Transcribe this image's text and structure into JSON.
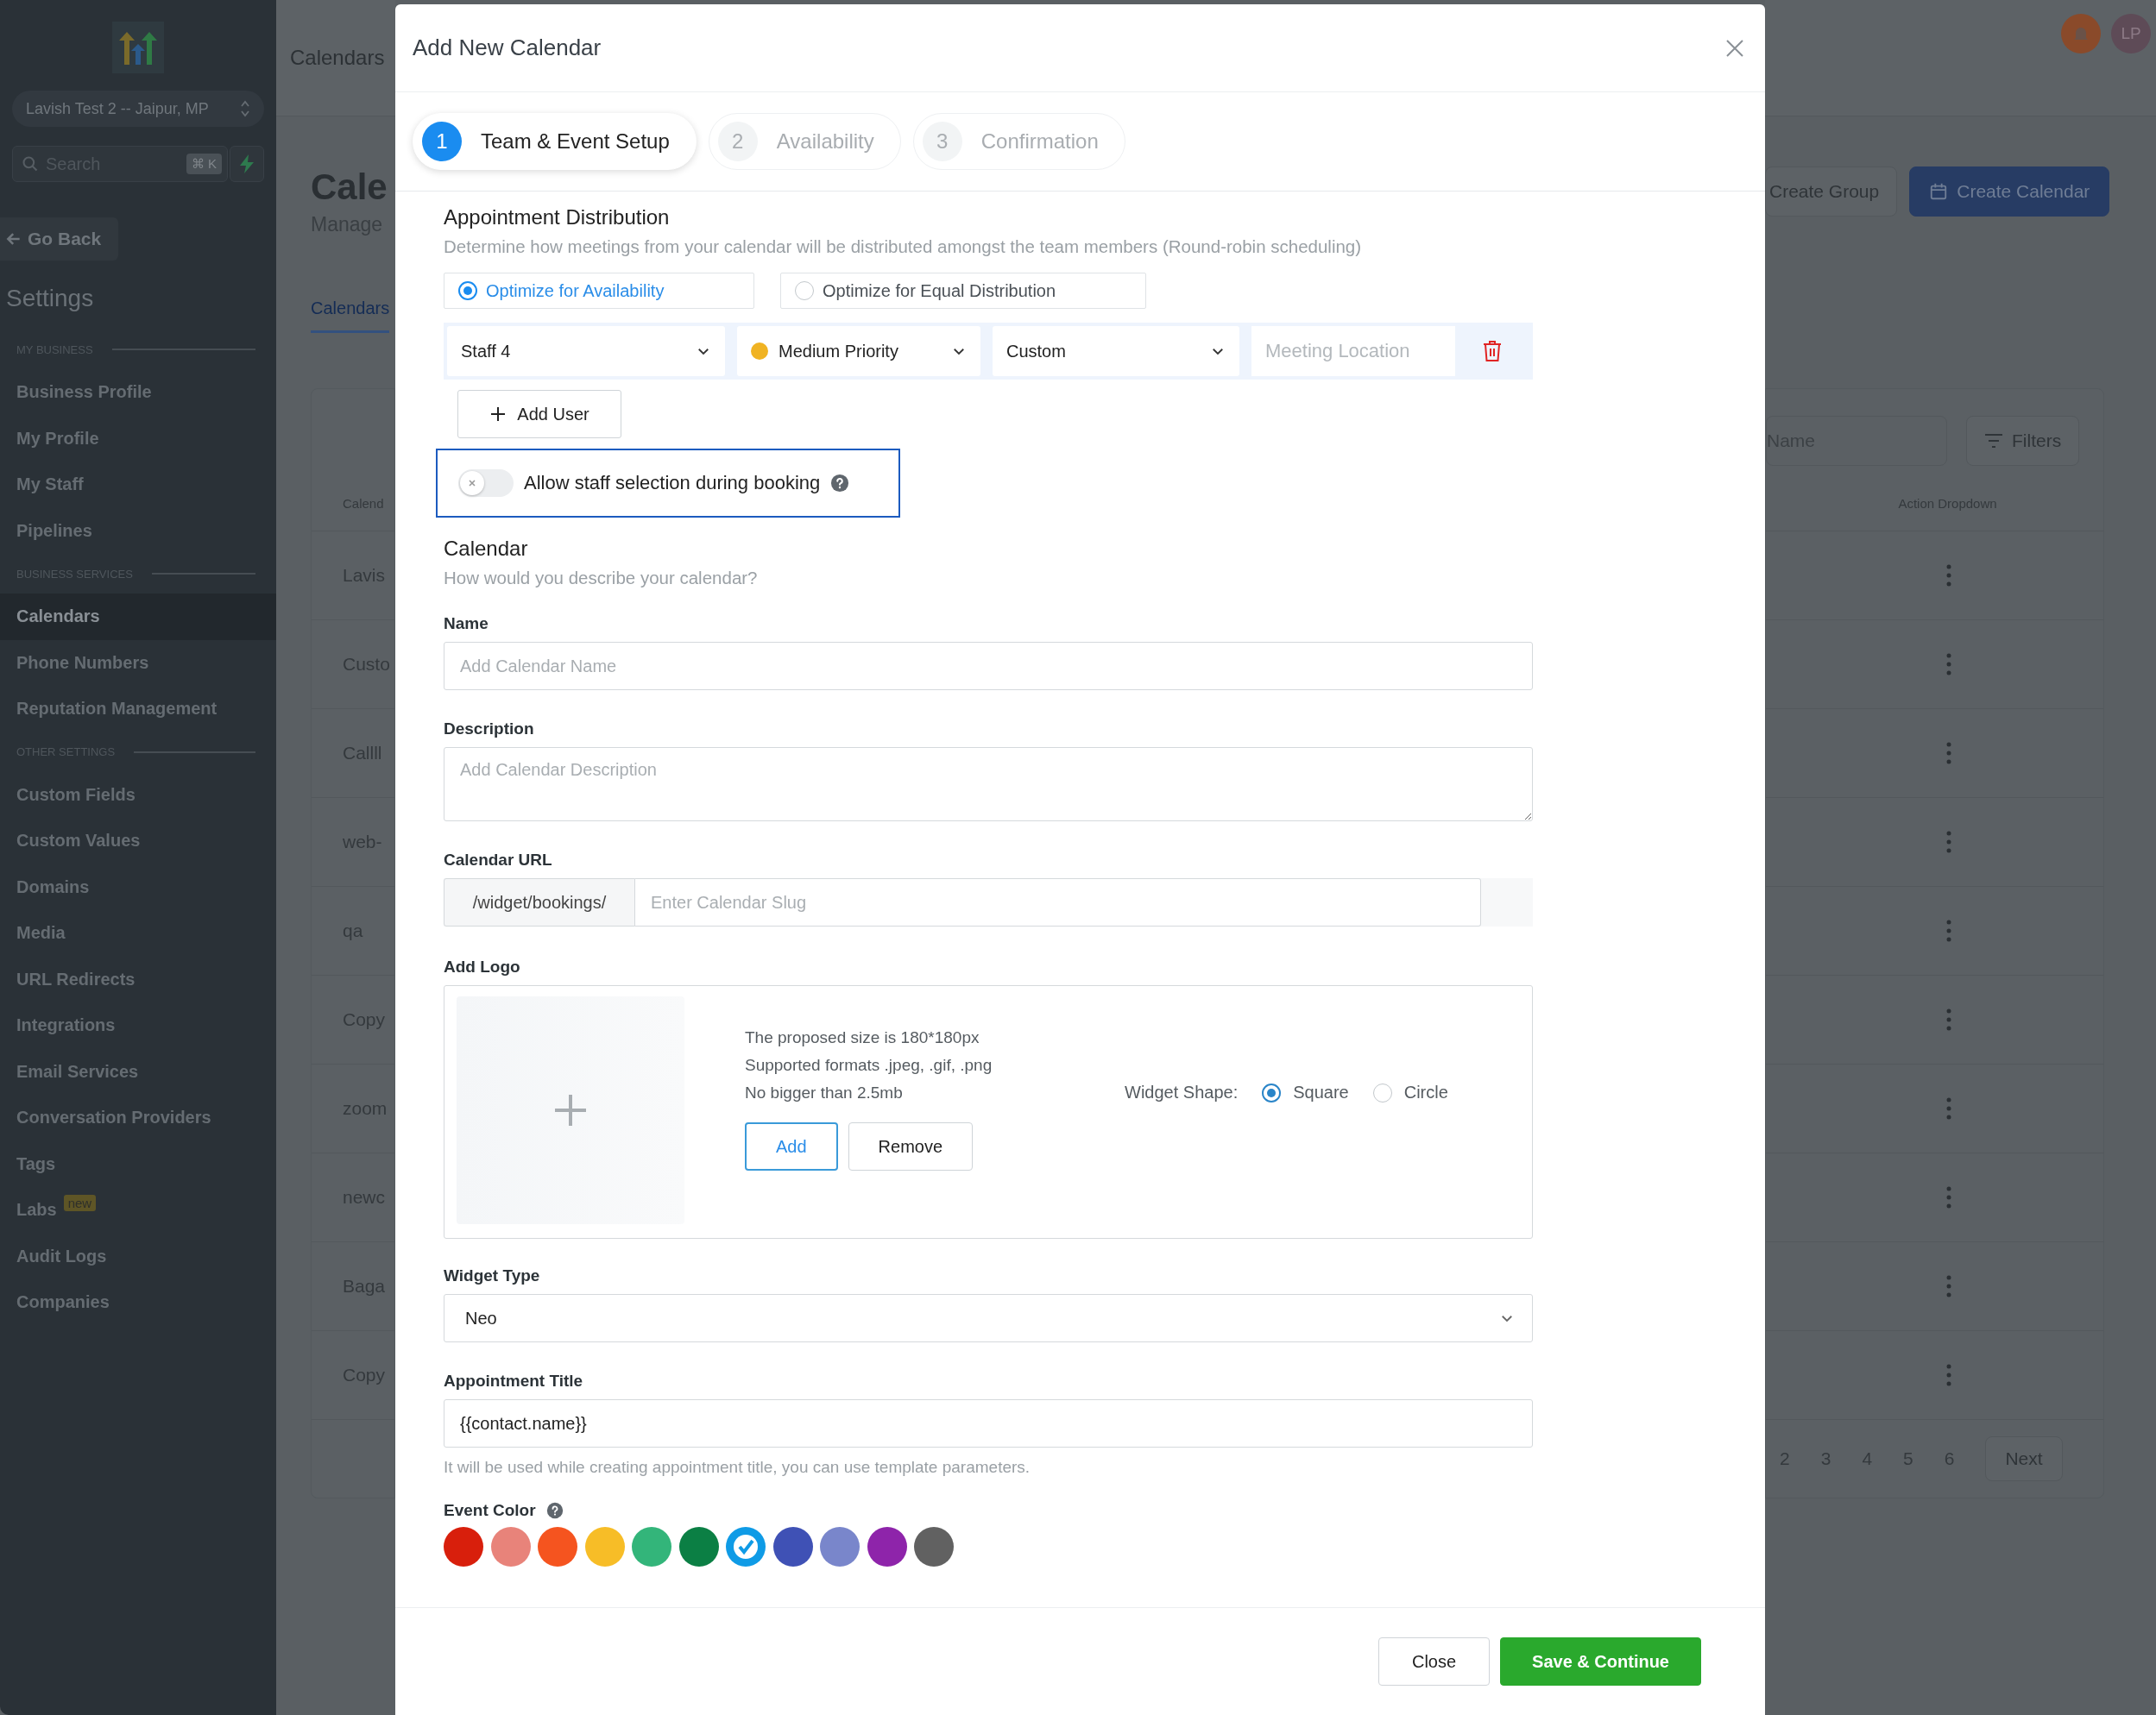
{
  "sidebar": {
    "account": "Lavish Test 2 -- Jaipur, MP",
    "search": {
      "placeholder": "Search",
      "shortcut": "⌘ K"
    },
    "back": "Go Back",
    "title": "Settings",
    "sections": [
      {
        "heading": "MY BUSINESS",
        "items": [
          {
            "label": "Business Profile",
            "selected": false
          },
          {
            "label": "My Profile",
            "selected": false
          },
          {
            "label": "My Staff",
            "selected": false
          },
          {
            "label": "Pipelines",
            "selected": false
          }
        ]
      },
      {
        "heading": "BUSINESS SERVICES",
        "items": [
          {
            "label": "Calendars",
            "selected": true
          },
          {
            "label": "Phone Numbers",
            "selected": false
          },
          {
            "label": "Reputation Management",
            "selected": false
          }
        ]
      },
      {
        "heading": "OTHER SETTINGS",
        "items": [
          {
            "label": "Custom Fields",
            "selected": false
          },
          {
            "label": "Custom Values",
            "selected": false
          },
          {
            "label": "Domains",
            "selected": false
          },
          {
            "label": "Media",
            "selected": false
          },
          {
            "label": "URL Redirects",
            "selected": false
          },
          {
            "label": "Integrations",
            "selected": false
          },
          {
            "label": "Email Services",
            "selected": false
          },
          {
            "label": "Conversation Providers",
            "selected": false
          },
          {
            "label": "Tags",
            "selected": false
          },
          {
            "label": "Labs",
            "selected": false,
            "badge": "new"
          },
          {
            "label": "Audit Logs",
            "selected": false
          },
          {
            "label": "Companies",
            "selected": false
          }
        ]
      }
    ]
  },
  "page": {
    "header": "Calendars",
    "title": "Cale",
    "subtitle": "Manage",
    "tabs": [
      {
        "label": "Calendars",
        "selected": true
      }
    ],
    "avatar": "LP",
    "create_group": "Create Group",
    "create_calendar": "Create Calendar",
    "search": {
      "placeholder": "Name"
    },
    "filters": "Filters",
    "columns": [
      "Calend",
      "Action Dropdown"
    ],
    "rows": [
      "Lavis",
      "Custo",
      "Callll",
      "web-",
      "qa",
      "Copy",
      "zoom",
      "newc",
      "Baga",
      "Copy"
    ],
    "pages": [
      "2",
      "3",
      "4",
      "5",
      "6"
    ],
    "next": "Next"
  },
  "modal": {
    "title": "Add New Calendar",
    "steps": [
      {
        "number": "1",
        "label": "Team & Event Setup",
        "selected": true
      },
      {
        "number": "2",
        "label": "Availability",
        "selected": false
      },
      {
        "number": "3",
        "label": "Confirmation",
        "selected": false
      }
    ],
    "distribution": {
      "title": "Appointment Distribution",
      "description": "Determine how meetings from your calendar will be distributed amongst the team members (Round-robin scheduling)",
      "options": [
        {
          "label": "Optimize for Availability",
          "selected": true
        },
        {
          "label": "Optimize for Equal Distribution",
          "selected": false
        }
      ],
      "staff": "Staff 4",
      "priority": "Medium Priority",
      "location": "Custom",
      "meeting_location": {
        "placeholder": "Meeting Location"
      },
      "add_user": "Add User",
      "staff_selection": {
        "label": "Allow staff selection during booking",
        "on": false
      }
    },
    "calendar": {
      "title": "Calendar",
      "description": "How would you describe your calendar?",
      "name": {
        "label": "Name",
        "placeholder": "Add Calendar Name"
      },
      "details": {
        "label": "Description",
        "placeholder": "Add Calendar Description"
      },
      "url": {
        "label": "Calendar URL",
        "prefix": "/widget/bookings/",
        "placeholder": "Enter Calendar Slug"
      },
      "logo": {
        "label": "Add Logo",
        "notes": [
          "The proposed size is 180*180px",
          "Supported formats .jpeg, .gif, .png",
          "No bigger than 2.5mb"
        ],
        "add": "Add",
        "remove": "Remove",
        "shape_label": "Widget Shape:",
        "shapes": [
          {
            "label": "Square",
            "selected": true
          },
          {
            "label": "Circle",
            "selected": false
          }
        ]
      },
      "widget_type": {
        "label": "Widget Type",
        "value": "Neo"
      },
      "appointment_title": {
        "label": "Appointment Title",
        "value": "{{contact.name}}",
        "hint": "It will be used while creating appointment title, you can use template parameters."
      },
      "event_color": {
        "label": "Event Color",
        "colors": [
          {
            "color": "#d81f0c",
            "selected": false
          },
          {
            "color": "#e8837a",
            "selected": false
          },
          {
            "color": "#f5541f",
            "selected": false
          },
          {
            "color": "#f7bd27",
            "selected": false
          },
          {
            "color": "#33b57a",
            "selected": false
          },
          {
            "color": "#0b7f44",
            "selected": false
          },
          {
            "color": "#0f9be6",
            "selected": true
          },
          {
            "color": "#3f51b5",
            "selected": false
          },
          {
            "color": "#7986cb",
            "selected": false
          },
          {
            "color": "#8e24aa",
            "selected": false
          },
          {
            "color": "#616161",
            "selected": false
          }
        ]
      }
    },
    "close": "Close",
    "save": "Save & Continue"
  }
}
